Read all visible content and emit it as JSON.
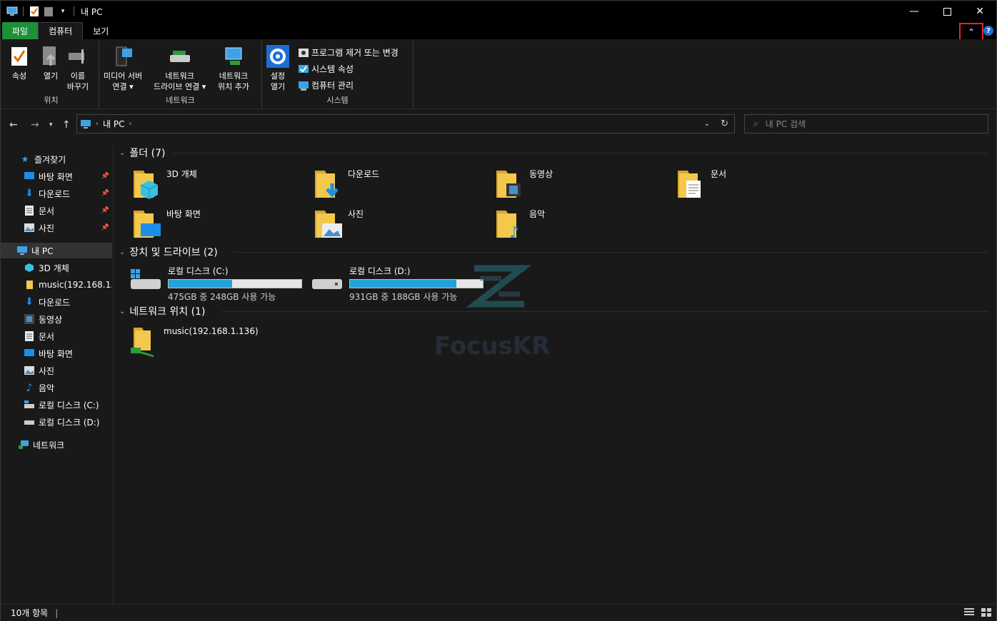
{
  "window": {
    "title": "내 PC"
  },
  "tabs": [
    {
      "label": "파일"
    },
    {
      "label": "컴퓨터"
    },
    {
      "label": "보기"
    }
  ],
  "ribbon": {
    "location": {
      "group": "위치",
      "properties": "속성",
      "open": "열기",
      "rename1": "이름",
      "rename2": "바꾸기"
    },
    "network": {
      "group": "네트워크",
      "media1": "미디어 서버",
      "media2": "연결",
      "map1": "네트워크",
      "map2": "드라이브 연결",
      "add1": "네트워크",
      "add2": "위치 추가"
    },
    "system": {
      "group": "시스템",
      "settings1": "설정",
      "settings2": "열기",
      "uninstall": "프로그램 제거 또는 변경",
      "sysprops": "시스템 속성",
      "manage": "컴퓨터 관리"
    }
  },
  "address": {
    "path": "내 PC",
    "search_placeholder": "내 PC 검색"
  },
  "nav": {
    "quick": "즐겨찾기",
    "quick_items": [
      "바탕 화면",
      "다운로드",
      "문서",
      "사진"
    ],
    "thispc": "내 PC",
    "pc_items": [
      "3D 개체",
      "music(192.168.1.136)",
      "다운로드",
      "동영상",
      "문서",
      "바탕 화면",
      "사진",
      "음악",
      "로컬 디스크 (C:)",
      "로컬 디스크 (D:)"
    ],
    "network": "네트워크"
  },
  "content": {
    "folders_header": "폴더 (7)",
    "folders": [
      "3D 개체",
      "다운로드",
      "동영상",
      "문서",
      "바탕 화면",
      "사진",
      "음악"
    ],
    "drives_header": "장치 및 드라이브 (2)",
    "drives": [
      {
        "name": "로컬 디스크 (C:)",
        "free": "475GB 중 248GB 사용 가능",
        "used_fraction": 0.48
      },
      {
        "name": "로컬 디스크 (D:)",
        "free": "931GB 중 188GB 사용 가능",
        "used_fraction": 0.8
      }
    ],
    "netloc_header": "네트워크 위치 (1)",
    "netlocs": [
      "music(192.168.1.136)"
    ]
  },
  "watermark": "FocusKR",
  "status": {
    "count": "10개 항목"
  },
  "colors": {
    "file_tab": "#1e8f3a",
    "highlight": "#e3262a",
    "bar": "#26a0da"
  }
}
